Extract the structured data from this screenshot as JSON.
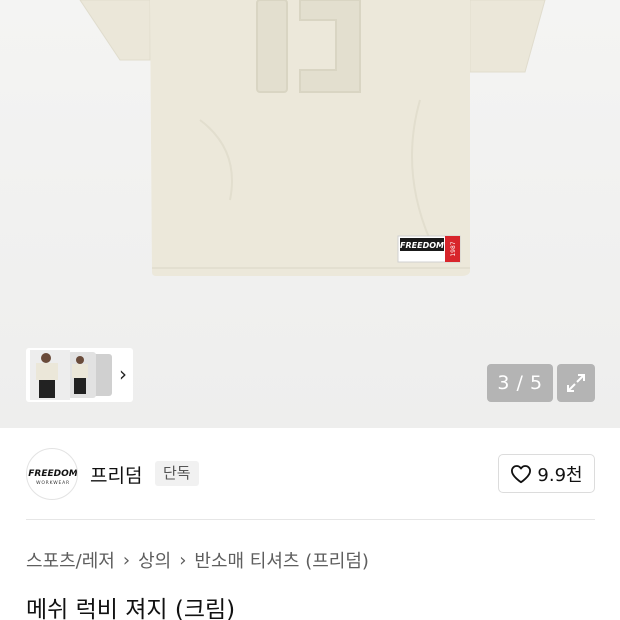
{
  "product_image": {
    "counter_current": "3",
    "counter_total": "5",
    "counter_text": "3 / 5",
    "tag_text": "FREEDOM",
    "tag_number": "1987"
  },
  "thumbnails": {
    "next_icon": "chevron-right-icon"
  },
  "brand": {
    "logo_text": "FREEDOM",
    "logo_subtext": "WORKWEAR",
    "name": "프리덤",
    "badge": "단독"
  },
  "like": {
    "icon": "heart-outline-icon",
    "count": "9.9천"
  },
  "breadcrumb": {
    "items": [
      "스포츠/레저",
      "상의",
      "반소매 티셔츠 (프리덤)"
    ]
  },
  "product": {
    "title": "메쉬 럭비 져지 (크림)"
  },
  "colors": {
    "shirt": "#ece8da",
    "overlay_button": "#b4b4b4",
    "tag_red": "#d8252b"
  }
}
